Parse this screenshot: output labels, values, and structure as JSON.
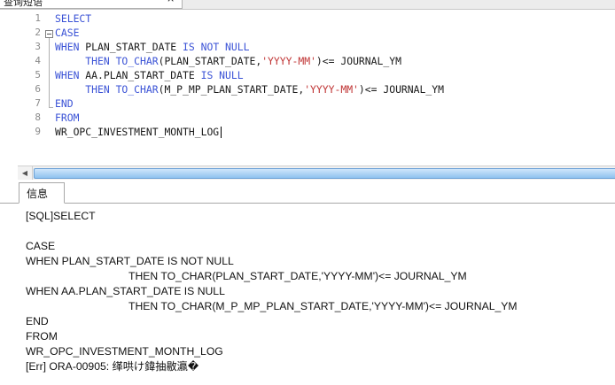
{
  "editor_tab": {
    "title": "查询短语",
    "close": "×"
  },
  "editor": {
    "lines": [
      {
        "n": "1",
        "tokens": [
          {
            "t": "SELECT",
            "k": "kw"
          }
        ]
      },
      {
        "n": "2",
        "tokens": [
          {
            "t": "CASE",
            "k": "kw"
          }
        ]
      },
      {
        "n": "3",
        "tokens": [
          {
            "t": "WHEN",
            "k": "kw"
          },
          {
            "t": " PLAN_START_DATE ",
            "k": ""
          },
          {
            "t": "IS NOT NULL",
            "k": "kw"
          }
        ]
      },
      {
        "n": "4",
        "tokens": [
          {
            "t": "     THEN ",
            "k": "kw"
          },
          {
            "t": "TO_CHAR",
            "k": "kw"
          },
          {
            "t": "(PLAN_START_DATE,",
            "k": ""
          },
          {
            "t": "'YYYY-MM'",
            "k": "str"
          },
          {
            "t": ")<= JOURNAL_YM",
            "k": ""
          }
        ]
      },
      {
        "n": "5",
        "tokens": [
          {
            "t": "WHEN",
            "k": "kw"
          },
          {
            "t": " AA.PLAN_START_DATE ",
            "k": ""
          },
          {
            "t": "IS NULL",
            "k": "kw"
          }
        ]
      },
      {
        "n": "6",
        "tokens": [
          {
            "t": "     THEN ",
            "k": "kw"
          },
          {
            "t": "TO_CHAR",
            "k": "kw"
          },
          {
            "t": "(M_P_MP_PLAN_START_DATE,",
            "k": ""
          },
          {
            "t": "'YYYY-MM'",
            "k": "str"
          },
          {
            "t": ")<= JOURNAL_YM",
            "k": ""
          }
        ]
      },
      {
        "n": "7",
        "tokens": [
          {
            "t": "END",
            "k": "kw"
          }
        ]
      },
      {
        "n": "8",
        "tokens": [
          {
            "t": "FROM",
            "k": "kw"
          }
        ]
      },
      {
        "n": "9",
        "tokens": [
          {
            "t": "WR_OPC_INVESTMENT_MONTH_LOG",
            "k": ""
          }
        ],
        "caret": true
      }
    ]
  },
  "hscroll": {
    "left_arrow": "◀"
  },
  "message_tab": {
    "label": "信息"
  },
  "messages": [
    {
      "text": "[SQL]SELECT",
      "indent": false
    },
    {
      "text": "",
      "indent": false
    },
    {
      "text": "CASE",
      "indent": false
    },
    {
      "text": "WHEN PLAN_START_DATE IS NOT NULL",
      "indent": false
    },
    {
      "text": "THEN TO_CHAR(PLAN_START_DATE,'YYYY-MM')<= JOURNAL_YM",
      "indent": true
    },
    {
      "text": "WHEN AA.PLAN_START_DATE IS NULL",
      "indent": false
    },
    {
      "text": "THEN TO_CHAR(M_P_MP_PLAN_START_DATE,'YYYY-MM')<= JOURNAL_YM",
      "indent": true
    },
    {
      "text": "END",
      "indent": false
    },
    {
      "text": "FROM",
      "indent": false
    },
    {
      "text": "WR_OPC_INVESTMENT_MONTH_LOG",
      "indent": false
    },
    {
      "text": "[Err] ORA-00905: 缂哄け鍏抽敭瀛�",
      "indent": false
    }
  ]
}
